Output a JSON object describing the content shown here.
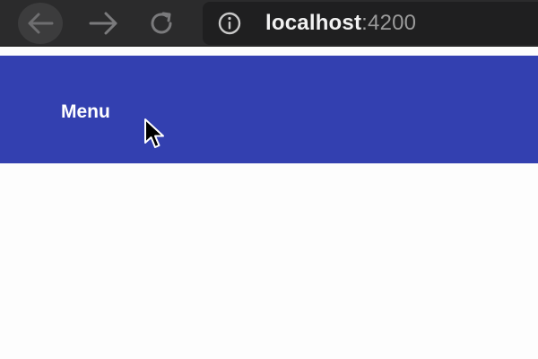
{
  "browser": {
    "address_bar": {
      "host": "localhost",
      "port": ":4200"
    },
    "icons": {
      "back": "arrow-left-icon",
      "forward": "arrow-right-icon",
      "reload": "reload-icon",
      "info": "info-icon"
    }
  },
  "app": {
    "toolbar": {
      "menu_label": "Menu",
      "color": "#3340b0"
    }
  },
  "colors": {
    "chrome": "#2b2b2c",
    "toolbar": "#3340b0",
    "page_background": "#fdfdfd"
  }
}
